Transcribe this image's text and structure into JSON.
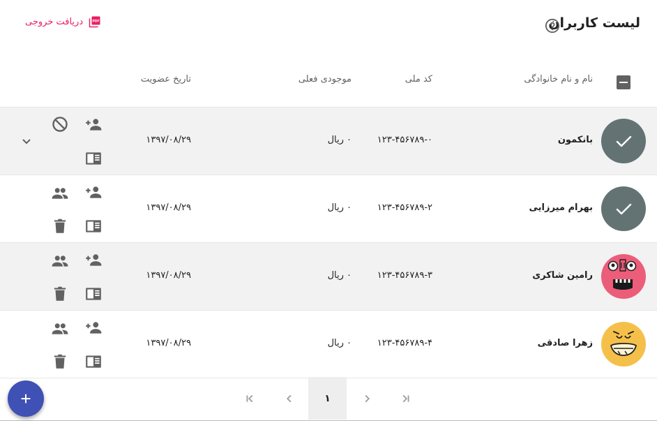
{
  "header": {
    "title": "لیست کاربران",
    "help_icon": "help-circle-icon",
    "export_label": "دریافت خروجی",
    "export_icon": "pdf-icon"
  },
  "table": {
    "columns": {
      "name": "نام و نام خانوادگی",
      "national_code": "کد ملی",
      "balance": "موجودی فعلی",
      "membership_date": "تاریخ عضویت"
    },
    "rows": [
      {
        "name": "بانکمون",
        "national_code": "۱۲۳-۴۵۶۷۸۹-۰",
        "balance": "۰ ریال",
        "date": "۱۳۹۷/۰۸/۲۹",
        "selected": true,
        "avatar": "check"
      },
      {
        "name": "بهرام میرزایی",
        "national_code": "۱۲۳-۴۵۶۷۸۹-۲",
        "balance": "۰ ریال",
        "date": "۱۳۹۷/۰۸/۲۹",
        "selected": false,
        "avatar": "check"
      },
      {
        "name": "رامین شاکری",
        "national_code": "۱۲۳-۴۵۶۷۸۹-۳",
        "balance": "۰ ریال",
        "date": "۱۳۹۷/۰۸/۲۹",
        "selected": false,
        "avatar": "pink-face"
      },
      {
        "name": "زهرا صادقی",
        "national_code": "۱۲۳-۴۵۶۷۸۹-۴",
        "balance": "۰ ریال",
        "date": "۱۳۹۷/۰۸/۲۹",
        "selected": false,
        "avatar": "yellow-face"
      }
    ]
  },
  "pagination": {
    "current_page": "۱"
  },
  "colors": {
    "accent_pink": "#e91e63",
    "fab_blue": "#3f51b5",
    "avatar_checked": "#637373"
  }
}
